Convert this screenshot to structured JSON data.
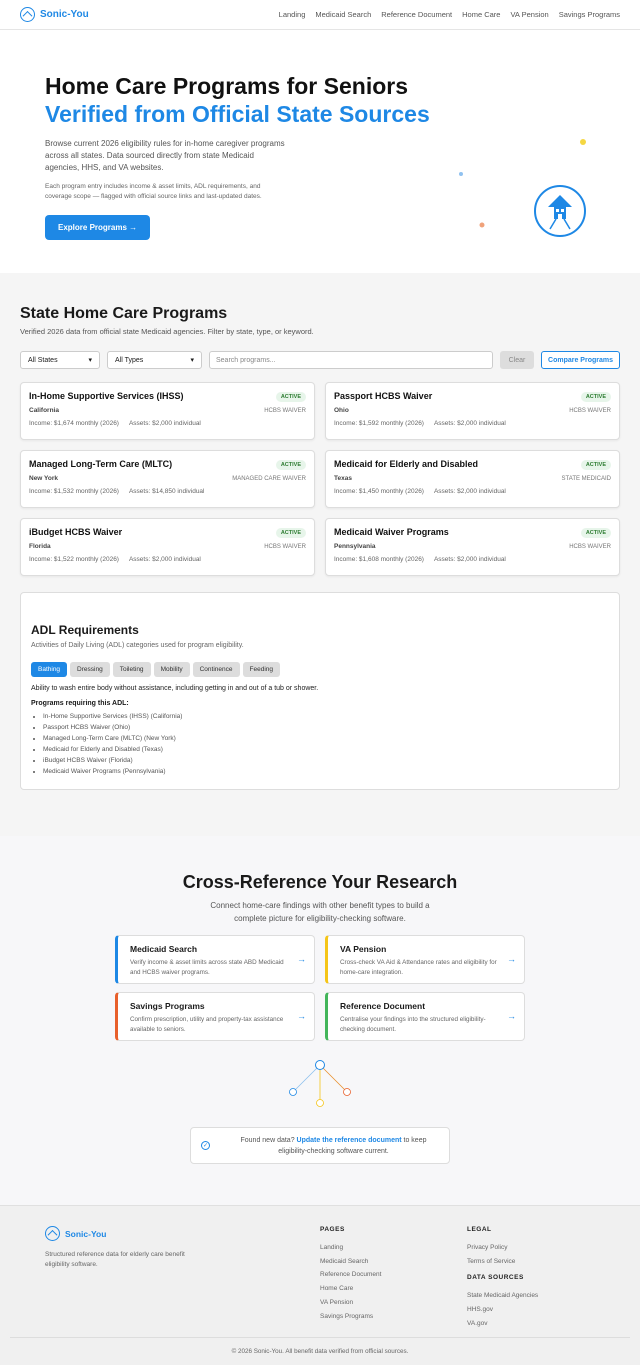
{
  "brand": {
    "name": "Sonic-You"
  },
  "nav": {
    "links": [
      "Landing",
      "Medicaid Search",
      "Reference Document",
      "Home Care",
      "VA Pension",
      "Savings Programs"
    ]
  },
  "hero": {
    "title_line1": "Home Care Programs for Seniors",
    "title_line2": "Verified from Official State Sources",
    "lead": "Browse current 2026 eligibility rules for in-home caregiver programs across all states. Data sourced directly from state Medicaid agencies, HHS, and VA websites.",
    "small": "Each program entry includes income & asset limits, ADL requirements, and coverage scope — flagged with official source links and last-updated dates.",
    "cta": "Explore Programs  →"
  },
  "programs": {
    "title": "State Home Care Programs",
    "subtitle": "Verified 2026 data from official state Medicaid agencies. Filter by state, type, or keyword.",
    "state_filter": "All States",
    "type_filter": "All Types",
    "search_placeholder": "Search programs...",
    "clear_label": "Clear",
    "compare_label": "Compare Programs",
    "cards": [
      {
        "title": "In-Home Supportive Services (IHSS)",
        "badge": "ACTIVE",
        "state": "California",
        "type": "HCBS WAIVER",
        "income": "Income: $1,674 monthly (2026)",
        "assets": "Assets: $2,000 individual"
      },
      {
        "title": "Passport HCBS Waiver",
        "badge": "ACTIVE",
        "state": "Ohio",
        "type": "HCBS WAIVER",
        "income": "Income: $1,592 monthly (2026)",
        "assets": "Assets: $2,000 individual"
      },
      {
        "title": "Managed Long-Term Care (MLTC)",
        "badge": "ACTIVE",
        "state": "New York",
        "type": "MANAGED CARE WAIVER",
        "income": "Income: $1,532 monthly (2026)",
        "assets": "Assets: $14,850 individual"
      },
      {
        "title": "Medicaid for Elderly and Disabled",
        "badge": "ACTIVE",
        "state": "Texas",
        "type": "STATE MEDICAID",
        "income": "Income: $1,450 monthly (2026)",
        "assets": "Assets: $2,000 individual"
      },
      {
        "title": "iBudget HCBS Waiver",
        "badge": "ACTIVE",
        "state": "Florida",
        "type": "HCBS WAIVER",
        "income": "Income: $1,522 monthly (2026)",
        "assets": "Assets: $2,000 individual"
      },
      {
        "title": "Medicaid Waiver Programs",
        "badge": "ACTIVE",
        "state": "Pennsylvania",
        "type": "HCBS WAIVER",
        "income": "Income: $1,608 monthly (2026)",
        "assets": "Assets: $2,000 individual"
      }
    ]
  },
  "adl": {
    "title": "ADL Requirements",
    "subtitle": "Activities of Daily Living (ADL) categories used for program eligibility.",
    "tabs": [
      "Bathing",
      "Dressing",
      "Toileting",
      "Mobility",
      "Continence",
      "Feeding"
    ],
    "active_tab": "Bathing",
    "description": "Ability to wash entire body without assistance, including getting in and out of a tub or shower.",
    "programs_heading": "Programs requiring this ADL:",
    "programs": [
      "In-Home Supportive Services (IHSS) (California)",
      "Passport HCBS Waiver (Ohio)",
      "Managed Long-Term Care (MLTC) (New York)",
      "Medicaid for Elderly and Disabled (Texas)",
      "iBudget HCBS Waiver (Florida)",
      "Medicaid Waiver Programs (Pennsylvania)"
    ]
  },
  "cross": {
    "title": "Cross-Reference Your Research",
    "subtitle": "Connect home-care findings with other benefit types to build a complete picture for eligibility-checking software.",
    "cards": [
      {
        "title": "Medicaid Search",
        "desc": "Verify income & asset limits across state ABD Medicaid and HCBS waiver programs.",
        "accent": "#1e88e5"
      },
      {
        "title": "VA Pension",
        "desc": "Cross-check VA Aid & Attendance rates and eligibility for home-care integration.",
        "accent": "#f5c518"
      },
      {
        "title": "Savings Programs",
        "desc": "Confirm prescription, utility and property-tax assistance available to seniors.",
        "accent": "#e8602c"
      },
      {
        "title": "Reference Document",
        "desc": "Centralise your findings into the structured eligibility-checking document.",
        "accent": "#43b55a"
      }
    ],
    "arrow": "→",
    "notice_prefix": "Found new data? ",
    "notice_link": "Update the reference document",
    "notice_suffix": " to keep eligibility-checking software current.",
    "check_icon": "✓"
  },
  "footer": {
    "desc": "Structured reference data for elderly care benefit eligibility software.",
    "pages_heading": "PAGES",
    "pages": [
      "Landing",
      "Medicaid Search",
      "Reference Document",
      "Home Care",
      "VA Pension",
      "Savings Programs"
    ],
    "legal_heading": "LEGAL",
    "legal": [
      "Privacy Policy",
      "Terms of Service"
    ],
    "sources_heading": "DATA SOURCES",
    "sources": [
      "State Medicaid Agencies",
      "HHS.gov",
      "VA.gov"
    ],
    "copyright": "© 2026 Sonic-You. All benefit data verified from official sources."
  },
  "colors": {
    "accent": "#1e88e5",
    "active_badge": "#2e7d32"
  }
}
